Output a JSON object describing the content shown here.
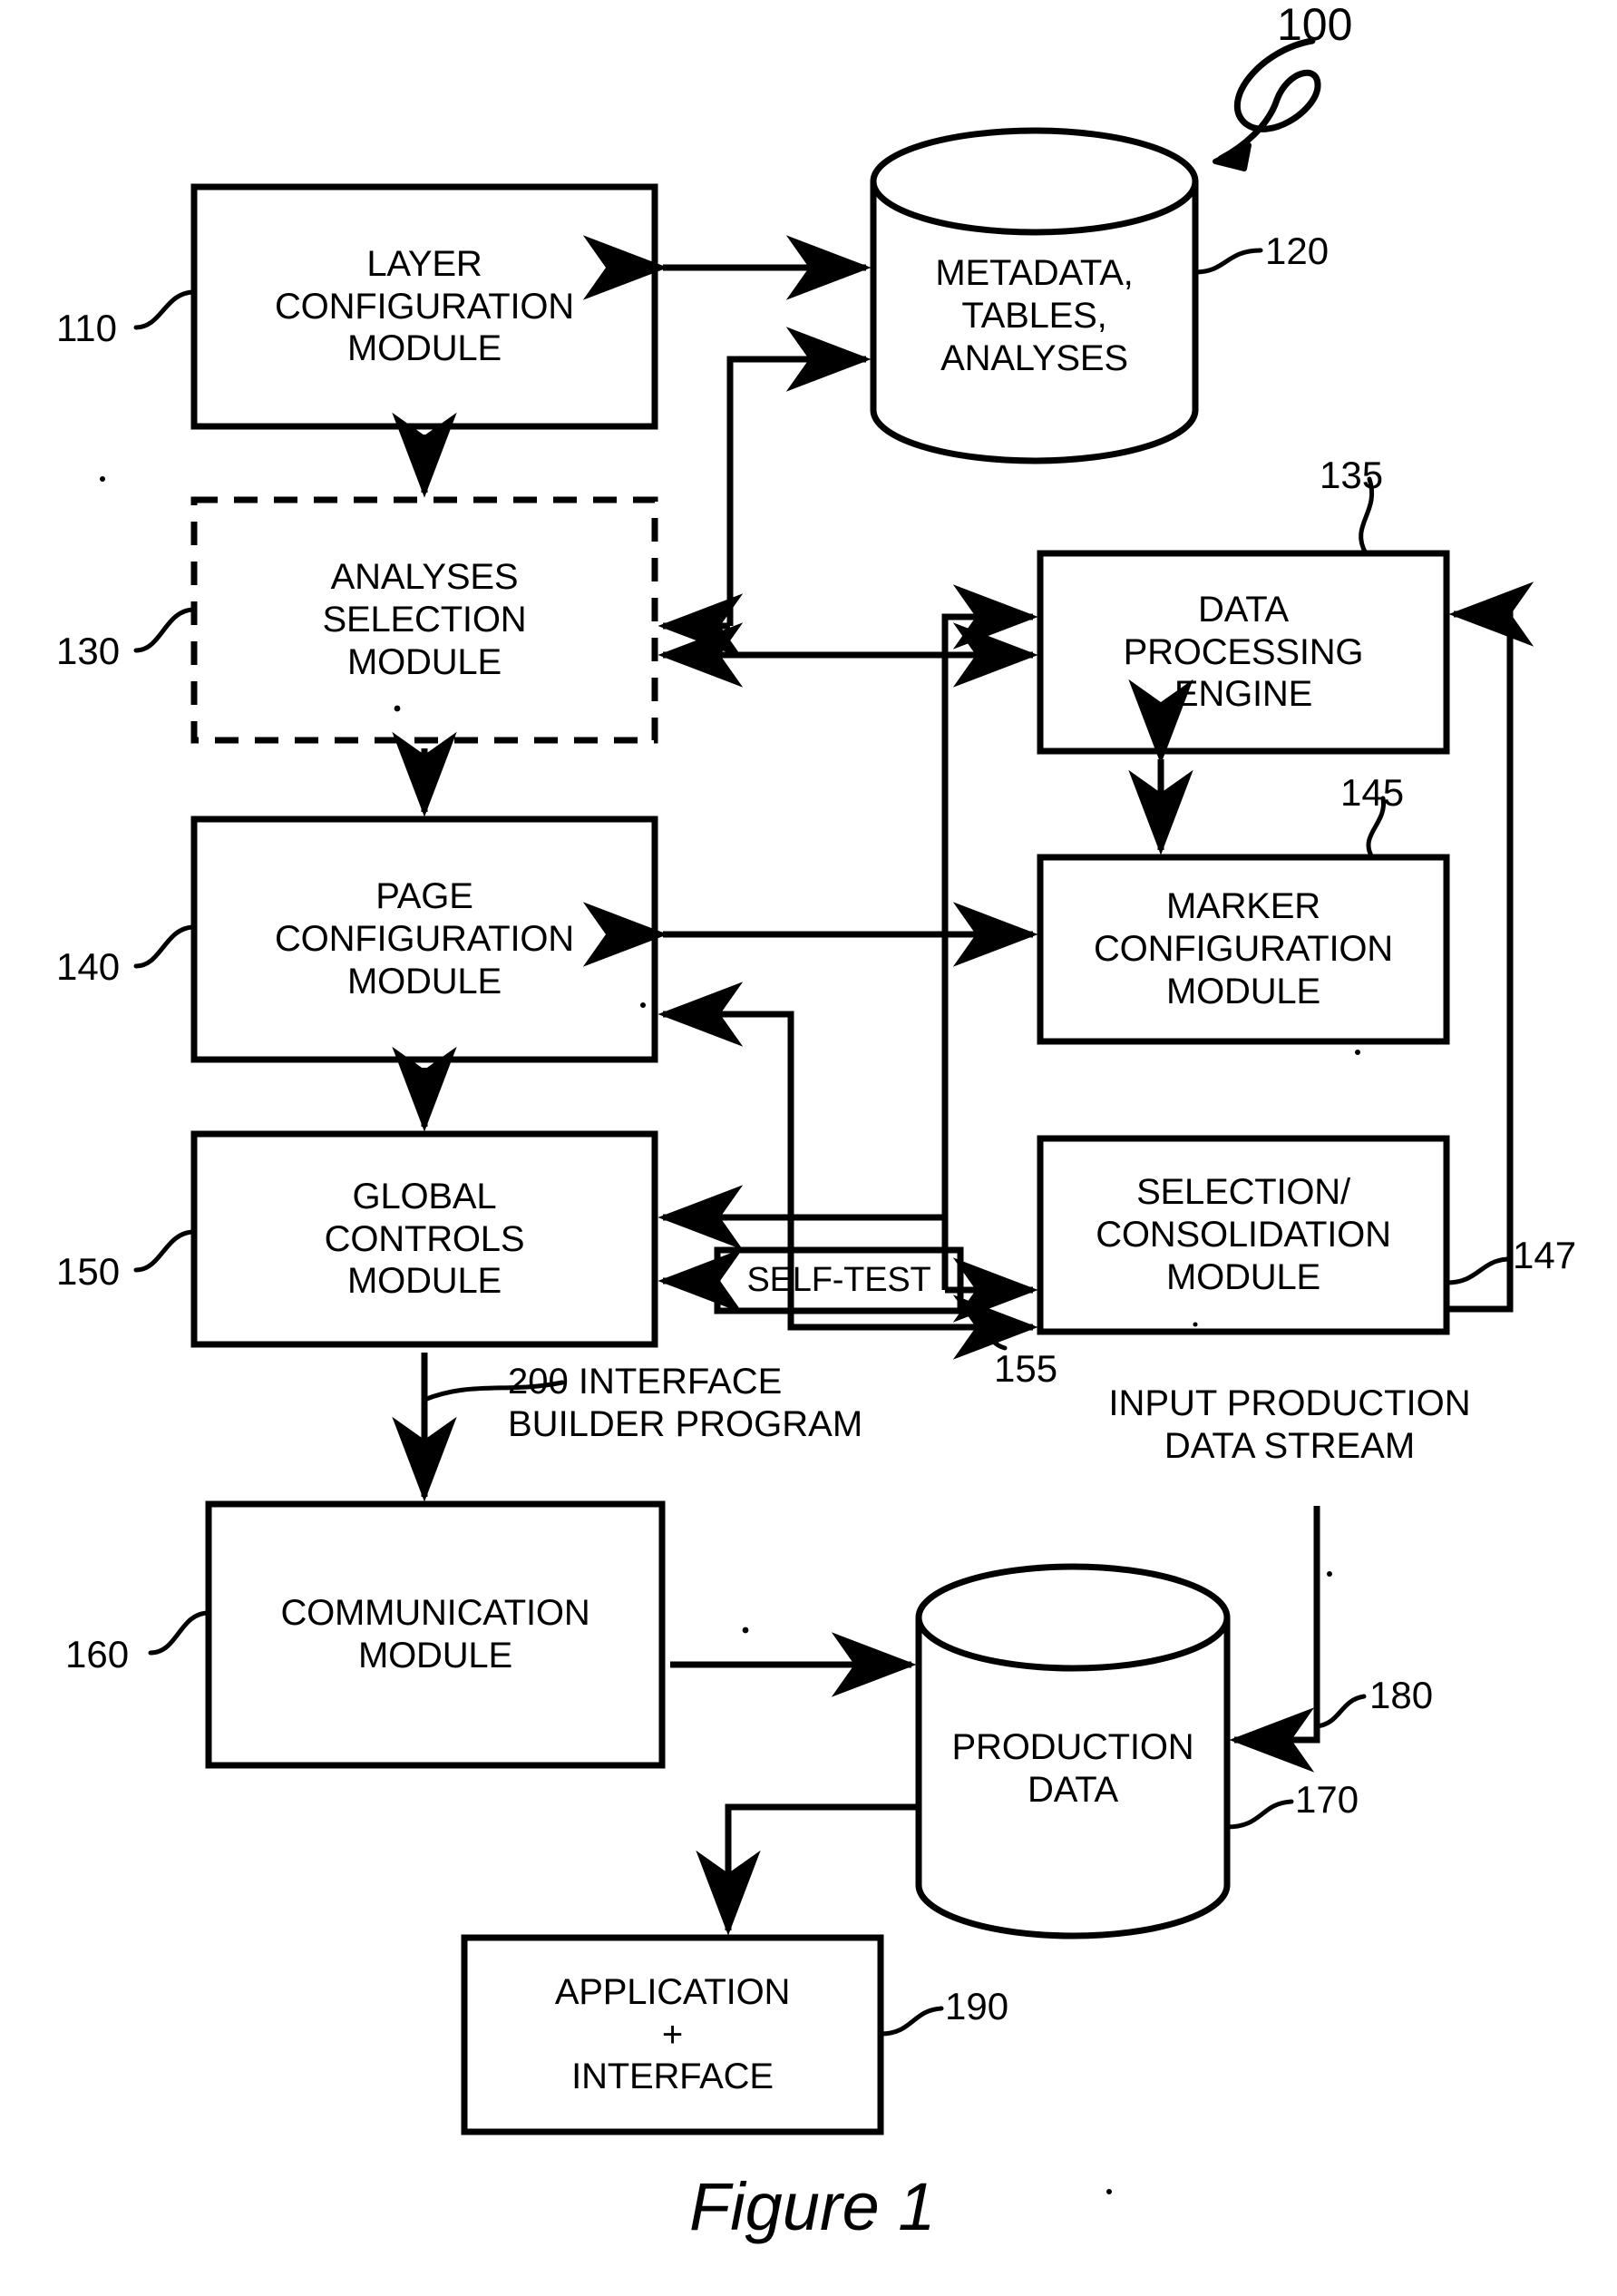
{
  "figure": {
    "caption": "Figure 1",
    "system_ref": "100"
  },
  "boxes": [
    {
      "id": "layer-configuration-module",
      "label": "LAYER\nCONFIGURATION\nMODULE",
      "ref": "110",
      "style": "solid"
    },
    {
      "id": "analyses-selection-module",
      "label": "ANALYSES\nSELECTION\nMODULE",
      "ref": "130",
      "style": "dashed"
    },
    {
      "id": "page-configuration-module",
      "label": "PAGE\nCONFIGURATION\nMODULE",
      "ref": "140",
      "style": "solid"
    },
    {
      "id": "global-controls-module",
      "label": "GLOBAL\nCONTROLS\nMODULE",
      "ref": "150",
      "style": "solid"
    },
    {
      "id": "communication-module",
      "label": "COMMUNICATION\nMODULE",
      "ref": "160",
      "style": "solid"
    },
    {
      "id": "data-processing-engine",
      "label": "DATA\nPROCESSING\nENGINE",
      "ref": "135",
      "style": "solid"
    },
    {
      "id": "marker-configuration-module",
      "label": "MARKER\nCONFIGURATION\nMODULE",
      "ref": "145",
      "style": "solid"
    },
    {
      "id": "selection-consolidation-module",
      "label": "SELECTION/\nCONSOLIDATION\nMODULE",
      "ref": "147",
      "style": "solid"
    },
    {
      "id": "self-test",
      "label": "SELF-TEST",
      "ref": "155",
      "style": "solid"
    },
    {
      "id": "application-interface",
      "label": "APPLICATION\n+\nINTERFACE",
      "ref": "190",
      "style": "solid"
    }
  ],
  "cylinders": [
    {
      "id": "metadata-tables-analyses",
      "label": "METADATA,\nTABLES,\nANALYSES",
      "ref": "120"
    },
    {
      "id": "production-data",
      "label": "PRODUCTION\nDATA",
      "ref": "170"
    }
  ],
  "annotations": [
    {
      "id": "interface-builder-program",
      "text": "200  INTERFACE\nBUILDER PROGRAM"
    },
    {
      "id": "input-production-data-stream",
      "text": "INPUT PRODUCTION\nDATA STREAM",
      "ref": "180"
    }
  ],
  "colors": {
    "stroke": "#000000",
    "background": "#ffffff"
  }
}
